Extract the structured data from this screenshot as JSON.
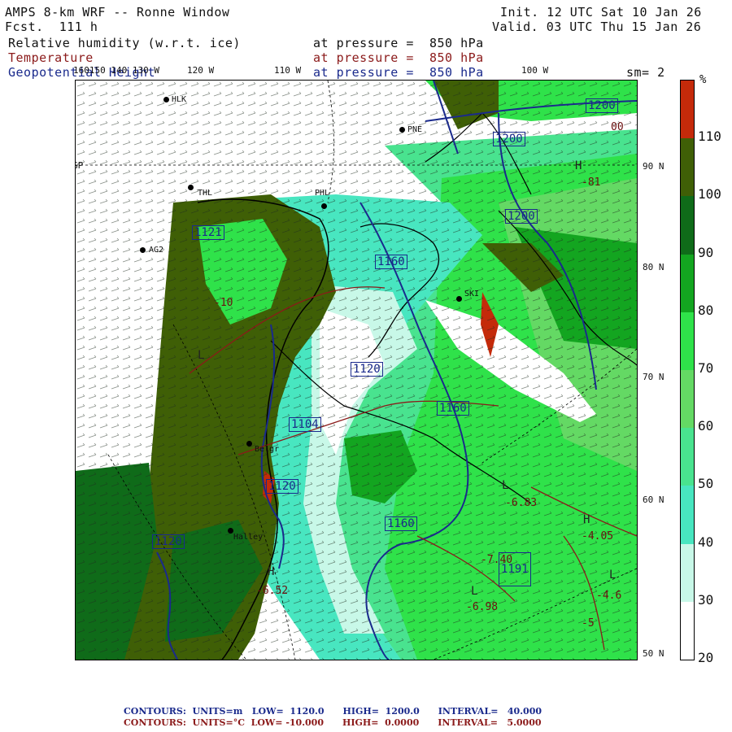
{
  "header": {
    "title": "AMPS 8-km WRF -- Ronne Window",
    "forecast": "Fcst.  111 h",
    "init": "Init. 12 UTC Sat 10 Jan 26",
    "valid": "Valid. 03 UTC Thu 15 Jan 26",
    "field1": "Relative humidity (w.r.t. ice)",
    "field2": "Temperature",
    "field3": "Geopotential Height",
    "pressure1": "at pressure =  850 hPa",
    "pressure2": "at pressure =  850 hPa",
    "pressure3": "at pressure =  850 hPa",
    "smoothing": "sm= 2"
  },
  "lon_labels": [
    "160150 140 130 W",
    "120 W",
    "110 W",
    "100 W"
  ],
  "lat_labels": [
    "90 N",
    "80 N",
    "70 N",
    "60 N",
    "50 N"
  ],
  "gp_label": "GP",
  "legend": {
    "unit": "%",
    "ticks": [
      "110",
      "100",
      "90",
      "80",
      "70",
      "60",
      "50",
      "40",
      "30",
      "20"
    ],
    "colors": [
      "#c42a0a",
      "#3f5f06",
      "#0f6b19",
      "#13a520",
      "#2fe24a",
      "#64d964",
      "#49e38f",
      "#48e6c0",
      "#c8f8e8",
      "#ffffff"
    ]
  },
  "stations": [
    {
      "name": "HLK"
    },
    {
      "name": "PNE"
    },
    {
      "name": "THL"
    },
    {
      "name": "PHL"
    },
    {
      "name": "AG2"
    },
    {
      "name": "SKI"
    },
    {
      "name": "Belgr"
    },
    {
      "name": "Halley"
    }
  ],
  "height_labels": [
    "1200",
    "1200",
    "1200",
    "1121",
    "1160",
    "1120",
    "1104",
    "1120",
    "1160",
    "1160",
    "1120",
    "1191"
  ],
  "temp_labels": [
    "-6.83",
    "-4.05",
    "-6.98",
    "-7.40",
    "-6.52",
    "-4.6",
    "-5",
    "-10",
    "-81",
    "00"
  ],
  "hl_labels": [
    "H",
    "L",
    "H",
    "L",
    "H",
    "L",
    "L"
  ],
  "footer": {
    "line1": "CONTOURS:  UNITS=m   LOW=  1120.0      HIGH=  1200.0      INTERVAL=   40.000",
    "line2": "CONTOURS:  UNITS=°C  LOW= -10.000      HIGH=  0.0000      INTERVAL=   5.0000"
  },
  "colors": {
    "height_contour": "#1a2a8c",
    "temp_contour": "#8b1a1a"
  }
}
